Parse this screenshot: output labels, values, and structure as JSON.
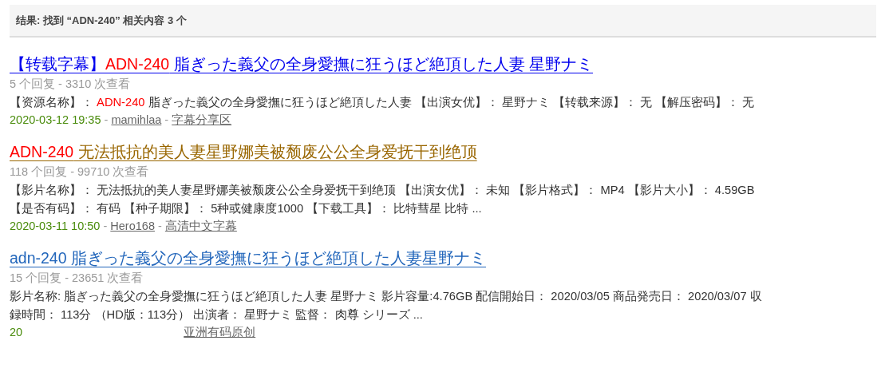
{
  "header": {
    "text": "结果: 找到 “ADN-240” 相关内容 3 个"
  },
  "results": [
    {
      "title": [
        {
          "text": "【转载字幕】",
          "highlight": false
        },
        {
          "text": "ADN-240",
          "highlight": true
        },
        {
          "text": " 脂ぎった義父の全身愛撫に狂うほど絶頂した人妻 星野ナミ",
          "highlight": false
        }
      ],
      "color": "#0000ee",
      "stats": "5 个回复 - 3310 次查看",
      "description": [
        {
          "text": "【资源名称】： ",
          "highlight": false
        },
        {
          "text": "ADN-240",
          "highlight": true
        },
        {
          "text": " 脂ぎった義父の全身愛撫に狂うほど絶頂した人妻 【出演女优】： 星野ナミ 【转载来源】： 无 【解压密码】： 无",
          "highlight": false
        }
      ],
      "date": "2020-03-12 19:35",
      "separator": "-",
      "author": "mamihlaa",
      "forum": "字幕分享区"
    },
    {
      "title": [
        {
          "text": "ADN-240",
          "highlight": true
        },
        {
          "text": " 无法抵抗的美人妻星野娜美被颓废公公全身爱抚干到绝顶",
          "highlight": false
        }
      ],
      "color": "#996600",
      "stats": "118 个回复 - 99710 次查看",
      "description": [
        {
          "text": "【影片名称】： 无法抵抗的美人妻星野娜美被颓废公公全身爱抚干到绝顶 【出演女优】： 未知 【影片格式】： MP4 【影片大小】： 4.59GB 【是否有码】： 有码 【种子期限】： 5种或健康度1000 【下载工具】： 比特彗星 比特 ...",
          "highlight": false
        }
      ],
      "date": "2020-03-11 10:50",
      "separator": "-",
      "author": "Hero168",
      "forum": "高清中文字幕"
    },
    {
      "title": [
        {
          "text": "adn-240 脂ぎった義父の全身愛撫に狂うほど絶頂した人妻星野ナミ",
          "highlight": false
        }
      ],
      "color": "#2266bb",
      "stats": "15 个回复 - 23651 次查看",
      "description": [
        {
          "text": "影片名称: 脂ぎった義父の全身愛撫に狂うほど絶頂した人妻 星野ナミ 影片容量:4.76GB 配信開始日： 2020/03/05 商品発売日： 2020/03/07 収録時間： 113分 （HD版：113分） 出演者： 星野ナミ 監督： 肉尊 シリーズ ...",
          "highlight": false
        }
      ],
      "date": "20",
      "forum": "亚洲有码原创"
    }
  ]
}
